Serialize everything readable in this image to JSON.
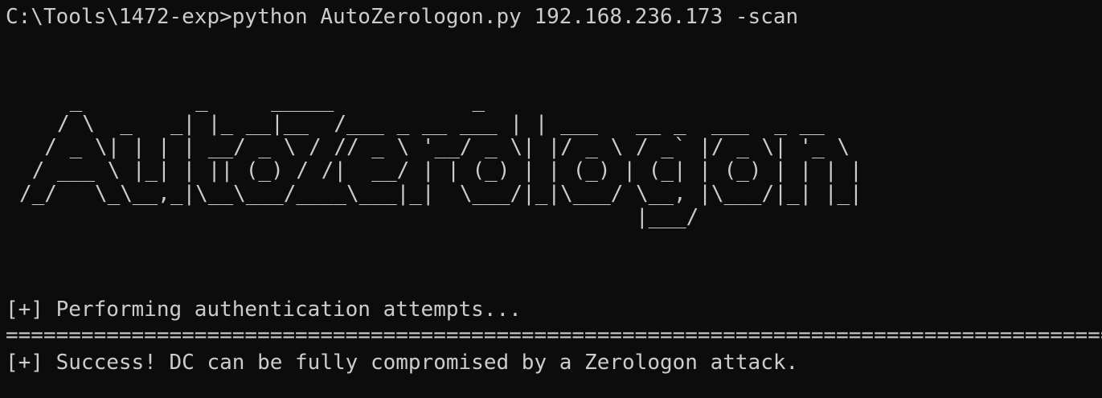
{
  "terminal": {
    "background": "#0c0c0c",
    "foreground": "#cccccc",
    "prompt_line": "C:\\Tools\\1472-exp>python AutoZerologon.py 192.168.236.173 -scan",
    "banner": "    _         _     _____           _\n   / \\  _   _| |_ __|__  /___ _ __ ___ | | ___   __ _  ___  _ __\n  / _ \\| | | | __/ _ \\ / // _ \\ '__/ _ \\| |/ _ \\ / _` |/ _ \\| '_ \\\n / ___ \\ |_| | || (_) / /|  __/ | | (_) | | (_) | (_| | (_) | | | |\n/_/   \\_\\__,_|\\__\\___/____\\___|_|  \\___/|_|\\___/ \\__, |\\___/|_| |_|\n                                                 |___/",
    "status_attempts": "[+] Performing authentication attempts...",
    "separator": "==========================================================================================",
    "status_success": "[+] Success! DC can be fully compromised by a Zerologon attack."
  }
}
